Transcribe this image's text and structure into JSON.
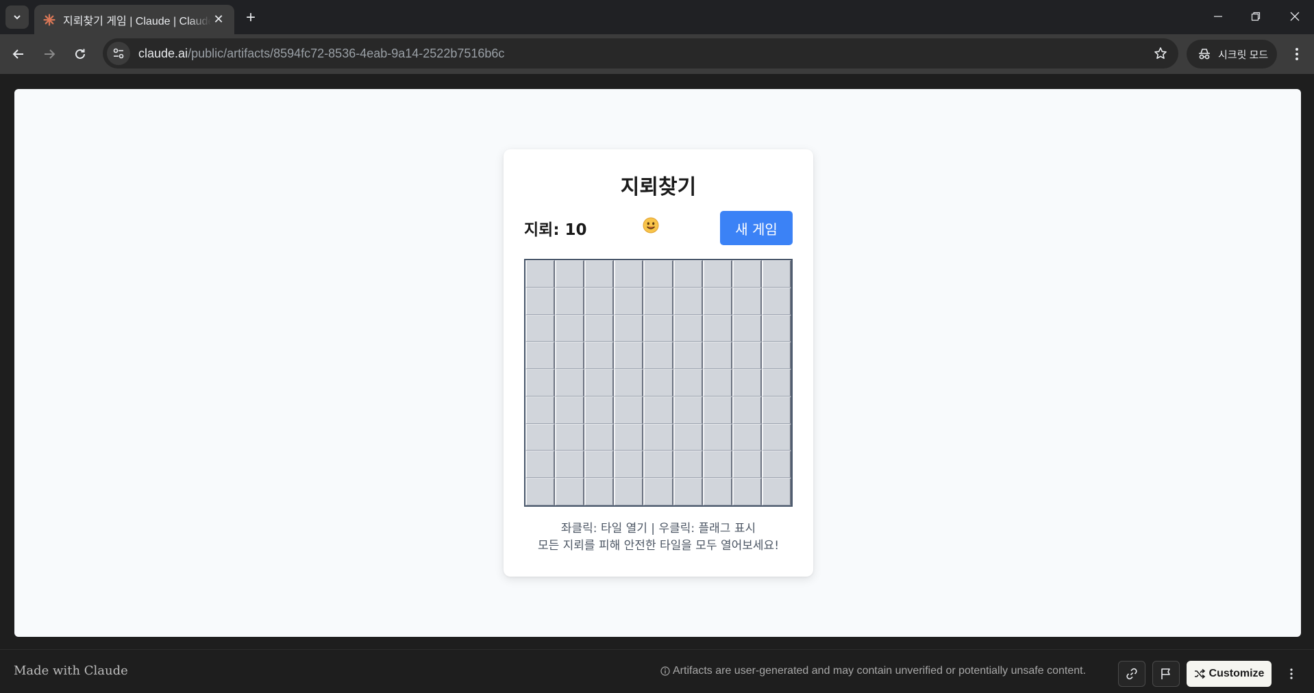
{
  "browser": {
    "tab": {
      "title": "지뢰찾기 게임 | Claude | Claude"
    },
    "url": {
      "host": "claude.ai",
      "path": "/public/artifacts/8594fc72-8536-4eab-9a14-2522b7516b6c"
    },
    "incognito_label": "시크릿 모드"
  },
  "game": {
    "title": "지뢰찾기",
    "mine_label": "지뢰: 10",
    "face": "smiley",
    "new_game_label": "새 게임",
    "board": {
      "rows": 9,
      "cols": 9,
      "state": "all-covered"
    },
    "help_line_1": "좌클릭: 타일 열기 | 우클릭: 플래그 표시",
    "help_line_2": "모든 지뢰를 피해 안전한 타일을 모두 열어보세요!"
  },
  "footer": {
    "made_with": "Made with Claude",
    "disclaimer": "Artifacts are user-generated and may contain unverified or potentially unsafe content.",
    "customize_label": "Customize"
  },
  "colors": {
    "accent_button": "#3b82f6",
    "tile": "#d1d5db",
    "board_border": "#475569",
    "page_bg": "#f8fafc"
  }
}
